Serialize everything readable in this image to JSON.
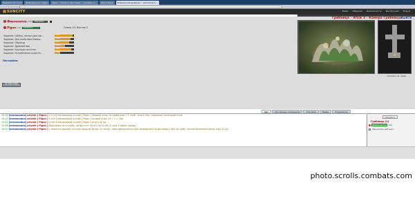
{
  "browser": {
    "tabs": [
      {
        "label": "Bsqbadrrunt.cry/4",
        "active": false
      },
      {
        "label": "Информация о Pigon",
        "active": false
      },
      {
        "label": "Pigon :: Каталог Доставка :: sociable.co...",
        "active": false
      },
      {
        "label": "about:blank",
        "active": false
      },
      {
        "label": "Бойцовский дневник :: заплаткага...",
        "active": true
      }
    ],
    "url": ""
  },
  "header": {
    "logo": "SUNCITY",
    "nav": [
      "Ваши",
      "Общение",
      "Безопасность",
      "Инструкция",
      "Форум"
    ]
  },
  "player": {
    "name": "Фиалонитка",
    "level": "[10]",
    "hp": "1042/1042",
    "mana": ""
  },
  "target": {
    "name": "Pigon",
    "level": "[11]",
    "hp": "3472/3772",
    "coords": "Север-19, Восток-2"
  },
  "tasks": [
    {
      "label": "Задание: Шейла, желая удостов...",
      "value": "28/30",
      "fill": 0.93
    },
    {
      "label": "Задание: Для осействия Юверр...",
      "value": "25/30",
      "fill": 0.83
    },
    {
      "label": "Задание: Образцы",
      "value": "16/21",
      "fill": 0.76
    },
    {
      "label": "Задание: Древний мох",
      "value": "22/40",
      "fill": 0.55
    },
    {
      "label": "Задание: Крупицы металла",
      "value": "34/40",
      "fill": 0.85
    },
    {
      "label": "Задание: Истребление существ...",
      "value": "11/40",
      "fill": 0.28
    }
  ],
  "settings_link": "Настройки",
  "tiny_button": "ИЗ ЭТОЙ ГЛАВЫ",
  "location": {
    "title": "Грибница - Этаж 3 - Камера Грибницы",
    "exit": "Выйти",
    "watch": "смотрим на север"
  },
  "chat_tabs": [
    {
      "label": "Чат",
      "active": true
    },
    {
      "label": "Системные сообщения",
      "active": false
    },
    {
      "label": "Торговля",
      "active": false
    },
    {
      "label": "Радио",
      "active": false
    },
    {
      "label": "Конфликты",
      "active": false
    }
  ],
  "chat": [
    {
      "time": "15:10",
      "src": "[незнакомка]",
      "priv": "private [ Pigon ]",
      "msg": "13:14 [незнакомка] private [ Pigon ] первый этаж 30 грибочков + 1 гриб , итого 1Кр, перехожу на второй этаж"
    },
    {
      "time": "15:14",
      "src": "[незнакомка]",
      "priv": "private [ Pigon ]",
      "msg": "14:02 [незнакомка] private [ Pigon ] второй этаж 33 + 1 = 1Кр"
    },
    {
      "time": "15:22",
      "src": "[незнакомка]",
      "priv": "private [ Pigon ]",
      "msg": "14:02 [незнакомка] private [ Pigon ] итого 42 кр"
    },
    {
      "time": "15:36",
      "src": "[незнакомка]",
      "priv": "private [ Pigon ]",
      "msg": "Персонаж не в клубе, не был тут (03.02.26 22:26 (3 часа 7 минут назад)"
    },
    {
      "time": "15:37",
      "src": "[незнакомка]",
      "priv": "private [ Pigon ]",
      "msg": "с момента выхода из игры прошло более 3х часов , свои обязанности как проводника по договору ( 6кр за гриб- считаю выполненными) жду 42 кр ."
    }
  ],
  "room": {
    "refresh": "Обновить",
    "title": "Грибница (1)",
    "player": "Фиалонитка",
    "player_level": "[10]",
    "auto_label": "Обновлять автомат."
  },
  "watermark": "photo.scrolls.combats.com"
}
